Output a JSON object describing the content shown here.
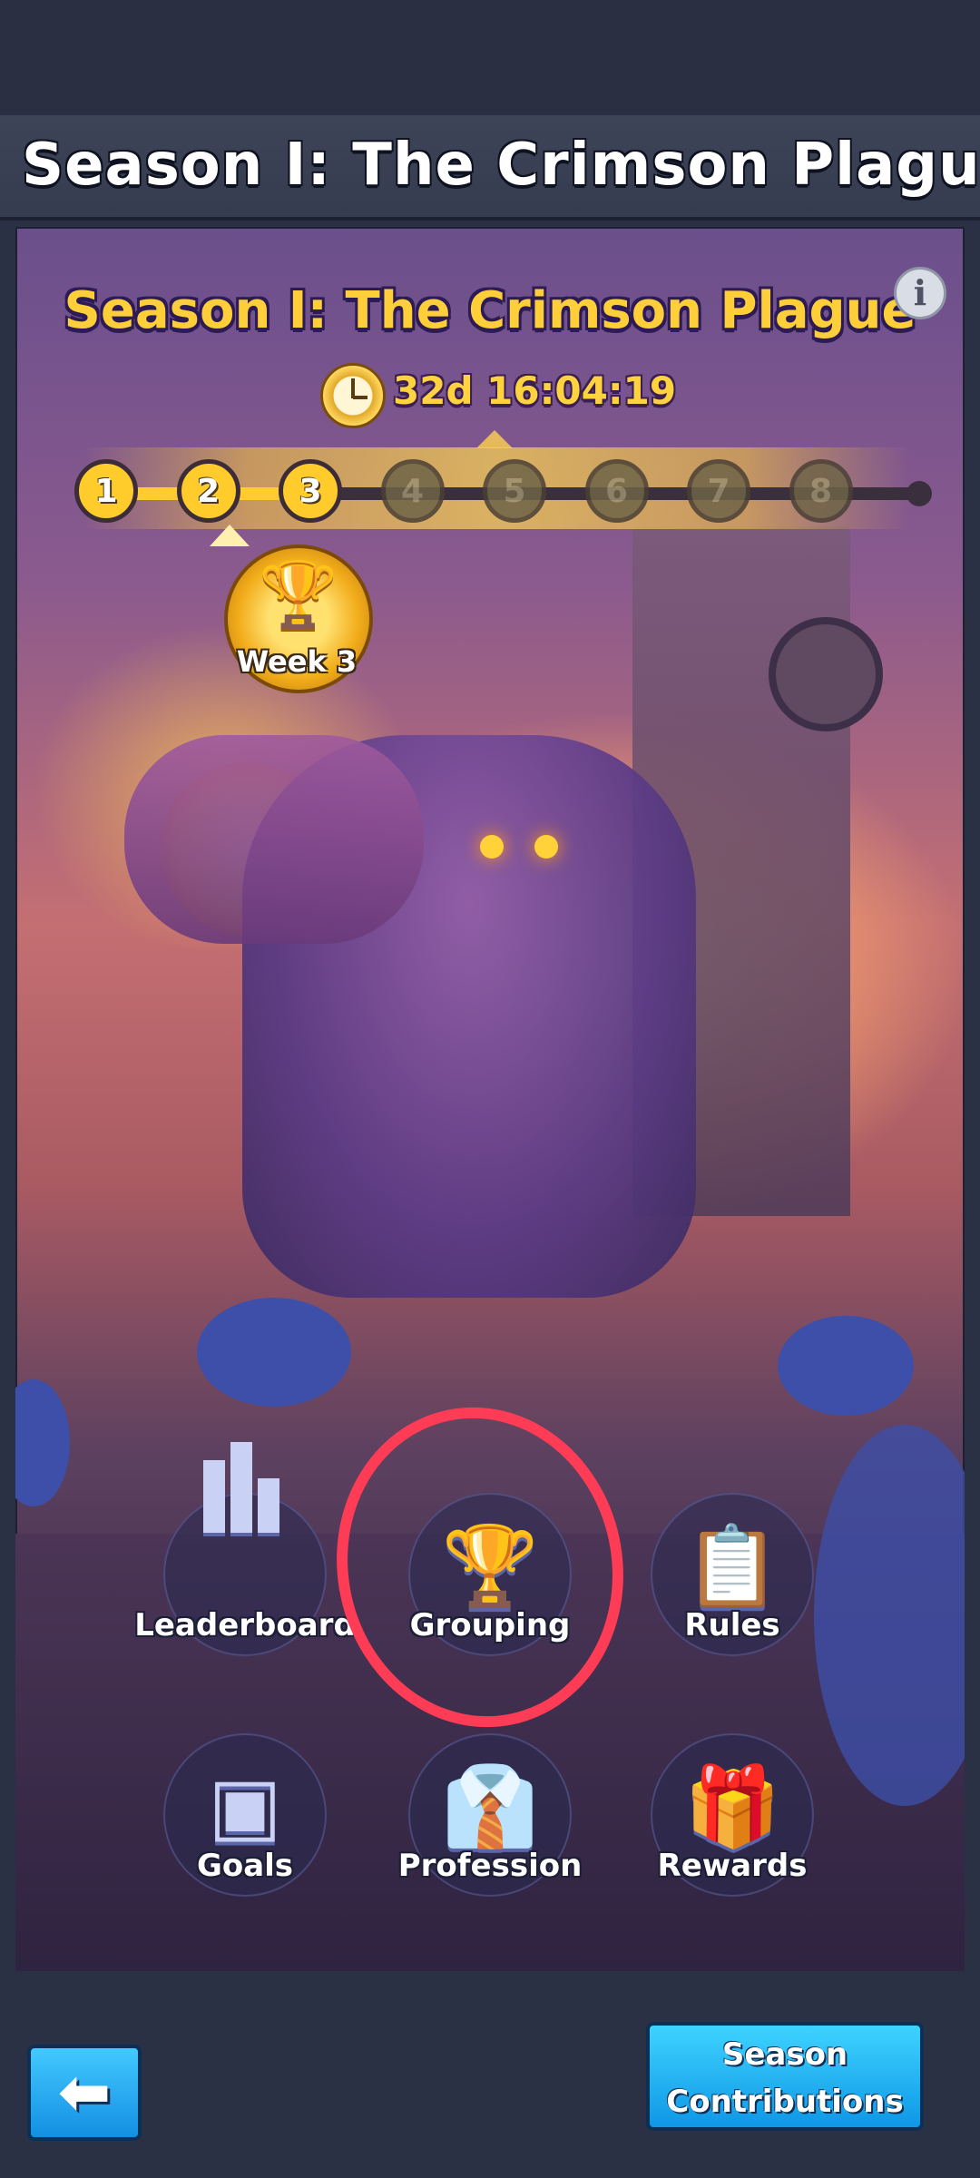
{
  "header": {
    "title": "Season I: The Crimson Plague"
  },
  "season": {
    "title": "Season I: The Crimson Plague",
    "info_icon": "info-icon",
    "timer": "32d 16:04:19",
    "timer_icon": "clock-icon",
    "progress": {
      "current_week": 3,
      "total_weeks": 8,
      "weeks": [
        "1",
        "2",
        "3",
        "4",
        "5",
        "6",
        "7",
        "8"
      ]
    },
    "current_week_label": "Week 3",
    "trophy_icon": "trophy-icon"
  },
  "menu": {
    "leaderboard": "Leaderboard",
    "grouping": "Grouping",
    "rules": "Rules",
    "goals": "Goals",
    "profession": "Profession",
    "rewards": "Rewards"
  },
  "footer": {
    "back_icon": "back-arrow-icon",
    "contributions_line1": "Season",
    "contributions_line2": "Contributions"
  },
  "colors": {
    "title_gold": "#ffcf3a",
    "button_blue": "#1fb0f0",
    "annotation_red": "#ff3c55"
  }
}
